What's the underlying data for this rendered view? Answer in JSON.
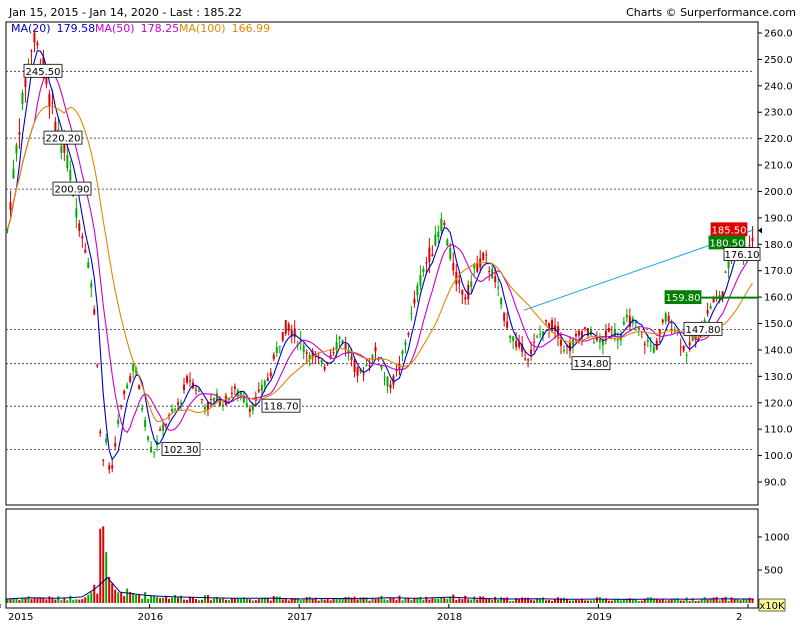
{
  "chart_data": {
    "type": "candlestick",
    "header": {
      "range_text": "Jan 15, 2015 - Jan 14, 2020 - Last : 185.22",
      "brand_text": "Charts © Surperformance.com",
      "last": 185.22
    },
    "moving_averages": [
      {
        "name": "MA(20)",
        "value": "179.58",
        "color": "#0000cc"
      },
      {
        "name": "MA(50)",
        "value": "178.25",
        "color": "#cc00cc"
      },
      {
        "name": "MA(100)",
        "value": "166.99",
        "color": "#e08a00"
      }
    ],
    "price_axis": {
      "ylim": [
        80,
        265
      ],
      "ticks": [
        "260.0",
        "250.0",
        "240.0",
        "230.0",
        "220.0",
        "210.0",
        "200.0",
        "190.0",
        "180.0",
        "170.0",
        "160.0",
        "150.0",
        "140.0",
        "130.0",
        "120.0",
        "110.0",
        "100.0",
        "90.0"
      ]
    },
    "volume_axis": {
      "ylim": [
        0,
        1300
      ],
      "ticks": [
        "1000",
        "500"
      ],
      "unit": "x10K"
    },
    "x_axis": {
      "labels": [
        "2015",
        "2016",
        "2017",
        "2018",
        "2019",
        "2"
      ],
      "label_years": [
        2015.0,
        2016.0,
        2017.0,
        2018.0,
        2019.0,
        2020.0
      ],
      "range_years": [
        2015.04,
        2020.04
      ]
    },
    "levels": [
      {
        "label": "245.50",
        "value": 245.5
      },
      {
        "label": "220.20",
        "value": 220.2
      },
      {
        "label": "200.90",
        "value": 200.9
      },
      {
        "label": "118.70",
        "value": 118.7
      },
      {
        "label": "102.30",
        "value": 102.3
      },
      {
        "label": "134.80",
        "value": 134.8
      },
      {
        "label": "147.80",
        "value": 147.8
      }
    ],
    "markers": [
      {
        "label": "185.50",
        "value": 185.5,
        "color": "#e00000"
      },
      {
        "label": "180.50",
        "value": 180.5,
        "color": "#008000"
      },
      {
        "label": "176.10",
        "value": 176.1,
        "color": "#ffffff"
      },
      {
        "label": "159.80",
        "value": 159.8,
        "color": "#008000"
      }
    ],
    "price_points": [
      [
        2015.04,
        180
      ],
      [
        2015.1,
        212
      ],
      [
        2015.16,
        238
      ],
      [
        2015.22,
        258
      ],
      [
        2015.28,
        250
      ],
      [
        2015.34,
        232
      ],
      [
        2015.4,
        220
      ],
      [
        2015.46,
        210
      ],
      [
        2015.52,
        190
      ],
      [
        2015.58,
        178
      ],
      [
        2015.64,
        150
      ],
      [
        2015.68,
        95
      ],
      [
        2015.71,
        105
      ],
      [
        2015.74,
        90
      ],
      [
        2015.78,
        110
      ],
      [
        2015.84,
        125
      ],
      [
        2015.9,
        135
      ],
      [
        2015.96,
        115
      ],
      [
        2016.02,
        100
      ],
      [
        2016.08,
        110
      ],
      [
        2016.14,
        115
      ],
      [
        2016.2,
        120
      ],
      [
        2016.26,
        130
      ],
      [
        2016.32,
        125
      ],
      [
        2016.38,
        118
      ],
      [
        2016.44,
        122
      ],
      [
        2016.5,
        120
      ],
      [
        2016.56,
        125
      ],
      [
        2016.62,
        122
      ],
      [
        2016.68,
        118
      ],
      [
        2016.74,
        124
      ],
      [
        2016.8,
        130
      ],
      [
        2016.86,
        142
      ],
      [
        2016.92,
        150
      ],
      [
        2016.98,
        145
      ],
      [
        2017.04,
        140
      ],
      [
        2017.1,
        138
      ],
      [
        2017.16,
        133
      ],
      [
        2017.22,
        140
      ],
      [
        2017.28,
        145
      ],
      [
        2017.34,
        138
      ],
      [
        2017.4,
        130
      ],
      [
        2017.46,
        135
      ],
      [
        2017.52,
        140
      ],
      [
        2017.58,
        128
      ],
      [
        2017.62,
        127
      ],
      [
        2017.68,
        135
      ],
      [
        2017.74,
        150
      ],
      [
        2017.8,
        165
      ],
      [
        2017.86,
        175
      ],
      [
        2017.92,
        182
      ],
      [
        2017.96,
        190
      ],
      [
        2018.0,
        178
      ],
      [
        2018.06,
        165
      ],
      [
        2018.12,
        160
      ],
      [
        2018.18,
        172
      ],
      [
        2018.24,
        175
      ],
      [
        2018.3,
        168
      ],
      [
        2018.36,
        155
      ],
      [
        2018.42,
        145
      ],
      [
        2018.48,
        140
      ],
      [
        2018.54,
        138
      ],
      [
        2018.6,
        145
      ],
      [
        2018.66,
        150
      ],
      [
        2018.72,
        148
      ],
      [
        2018.78,
        140
      ],
      [
        2018.84,
        143
      ],
      [
        2018.9,
        148
      ],
      [
        2018.96,
        145
      ],
      [
        2019.02,
        142
      ],
      [
        2019.08,
        148
      ],
      [
        2019.14,
        145
      ],
      [
        2019.2,
        152
      ],
      [
        2019.26,
        148
      ],
      [
        2019.32,
        143
      ],
      [
        2019.38,
        140
      ],
      [
        2019.44,
        152
      ],
      [
        2019.5,
        150
      ],
      [
        2019.56,
        142
      ],
      [
        2019.6,
        139
      ],
      [
        2019.64,
        145
      ],
      [
        2019.7,
        150
      ],
      [
        2019.76,
        158
      ],
      [
        2019.82,
        160
      ],
      [
        2019.86,
        170
      ],
      [
        2019.9,
        178
      ],
      [
        2019.94,
        182
      ],
      [
        2019.98,
        175
      ],
      [
        2020.04,
        185
      ]
    ],
    "volume_points": [
      [
        2015.04,
        60
      ],
      [
        2015.2,
        80
      ],
      [
        2015.4,
        70
      ],
      [
        2015.6,
        100
      ],
      [
        2015.66,
        300
      ],
      [
        2015.68,
        1300
      ],
      [
        2015.7,
        700
      ],
      [
        2015.72,
        350
      ],
      [
        2015.76,
        180
      ],
      [
        2015.85,
        150
      ],
      [
        2016.0,
        110
      ],
      [
        2016.2,
        90
      ],
      [
        2016.4,
        80
      ],
      [
        2016.6,
        70
      ],
      [
        2016.8,
        75
      ],
      [
        2017.0,
        60
      ],
      [
        2017.2,
        70
      ],
      [
        2017.4,
        65
      ],
      [
        2017.6,
        80
      ],
      [
        2017.8,
        70
      ],
      [
        2018.0,
        90
      ],
      [
        2018.2,
        70
      ],
      [
        2018.4,
        60
      ],
      [
        2018.6,
        65
      ],
      [
        2018.8,
        55
      ],
      [
        2019.0,
        60
      ],
      [
        2019.2,
        55
      ],
      [
        2019.4,
        60
      ],
      [
        2019.6,
        58
      ],
      [
        2019.8,
        62
      ],
      [
        2020.04,
        60
      ]
    ]
  }
}
